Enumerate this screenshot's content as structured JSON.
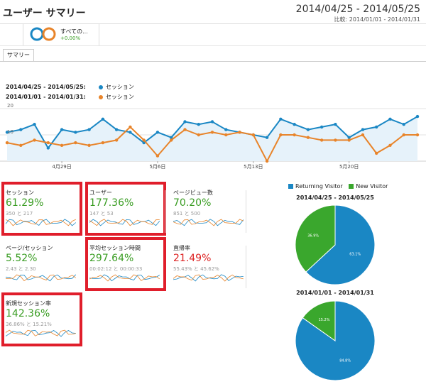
{
  "header": {
    "title": "ユーザー サマリー",
    "date_range": "2014/04/25 - 2014/05/25",
    "compare": "比較: 2014/01/01 - 2014/01/31"
  },
  "segment": {
    "label": "すべての...",
    "pct": "+0.00%"
  },
  "tabs": [
    "サマリー"
  ],
  "legend": [
    {
      "range": "2014/04/25 - 2014/05/25:",
      "metric": "セッション",
      "color": "#1a87c4"
    },
    {
      "range": "2014/01/01 - 2014/01/31:",
      "metric": "セッション",
      "color": "#e8842a"
    }
  ],
  "colors": {
    "blue": "#1a87c4",
    "orange": "#e8842a",
    "green": "#3a9d23",
    "red": "#dd2222",
    "highlight_box": "#e01e2b"
  },
  "chart_data": {
    "type": "line",
    "y_ticks": [
      "20",
      "10"
    ],
    "x_tick_labels": [
      "4月29日",
      "5月6日",
      "5月13日",
      "5月20日"
    ],
    "ylim": [
      0,
      20
    ],
    "series": [
      {
        "values": [
          11,
          12,
          14,
          5,
          12,
          11,
          12,
          16,
          12,
          11,
          7,
          11,
          9,
          15,
          14,
          15,
          12,
          11,
          10,
          9,
          16,
          14,
          12,
          13,
          14,
          9,
          12,
          13,
          16,
          14,
          17
        ]
      },
      {
        "values": [
          7,
          6,
          8,
          7,
          6,
          7,
          6,
          7,
          8,
          13,
          8,
          2,
          8,
          12,
          10,
          11,
          10,
          11,
          10,
          0,
          10,
          10,
          9,
          8,
          8,
          8,
          10,
          3,
          6,
          10,
          10
        ]
      }
    ]
  },
  "metrics": [
    {
      "name": "セッション",
      "value": "61.29%",
      "cmp": "350 と 217",
      "tone": "green",
      "highlight": true
    },
    {
      "name": "ユーザー",
      "value": "177.36%",
      "cmp": "147 と 53",
      "tone": "green",
      "highlight": true
    },
    {
      "name": "ページビュー数",
      "value": "70.20%",
      "cmp": "851 と 500",
      "tone": "green",
      "highlight": false
    },
    {
      "name": "ページ/セッション",
      "value": "5.52%",
      "cmp": "2.43 と 2.30",
      "tone": "green",
      "highlight": false
    },
    {
      "name": "平均セッション時間",
      "value": "297.64%",
      "cmp": "00:02:12 と 00:00:33",
      "tone": "green",
      "highlight": true
    },
    {
      "name": "直帰率",
      "value": "21.49%",
      "cmp": "55.43% と 45.62%",
      "tone": "red",
      "highlight": false
    },
    {
      "name": "新規セッション率",
      "value": "142.36%",
      "cmp": "36.86% と 15.21%",
      "tone": "green",
      "highlight": true
    }
  ],
  "pie_legend": [
    {
      "label": "Returning Visitor",
      "color": "#1a87c4"
    },
    {
      "label": "New Visitor",
      "color": "#3aa72d"
    }
  ],
  "pies": [
    {
      "title": "2014/04/25 - 2014/05/25",
      "returning_pct": 63.1,
      "new_pct": 36.9,
      "returning_label": "63.1%",
      "new_label": "36.9%"
    },
    {
      "title": "2014/01/01 - 2014/01/31",
      "returning_pct": 84.8,
      "new_pct": 15.2,
      "returning_label": "84.8%",
      "new_label": "15.2%"
    }
  ]
}
